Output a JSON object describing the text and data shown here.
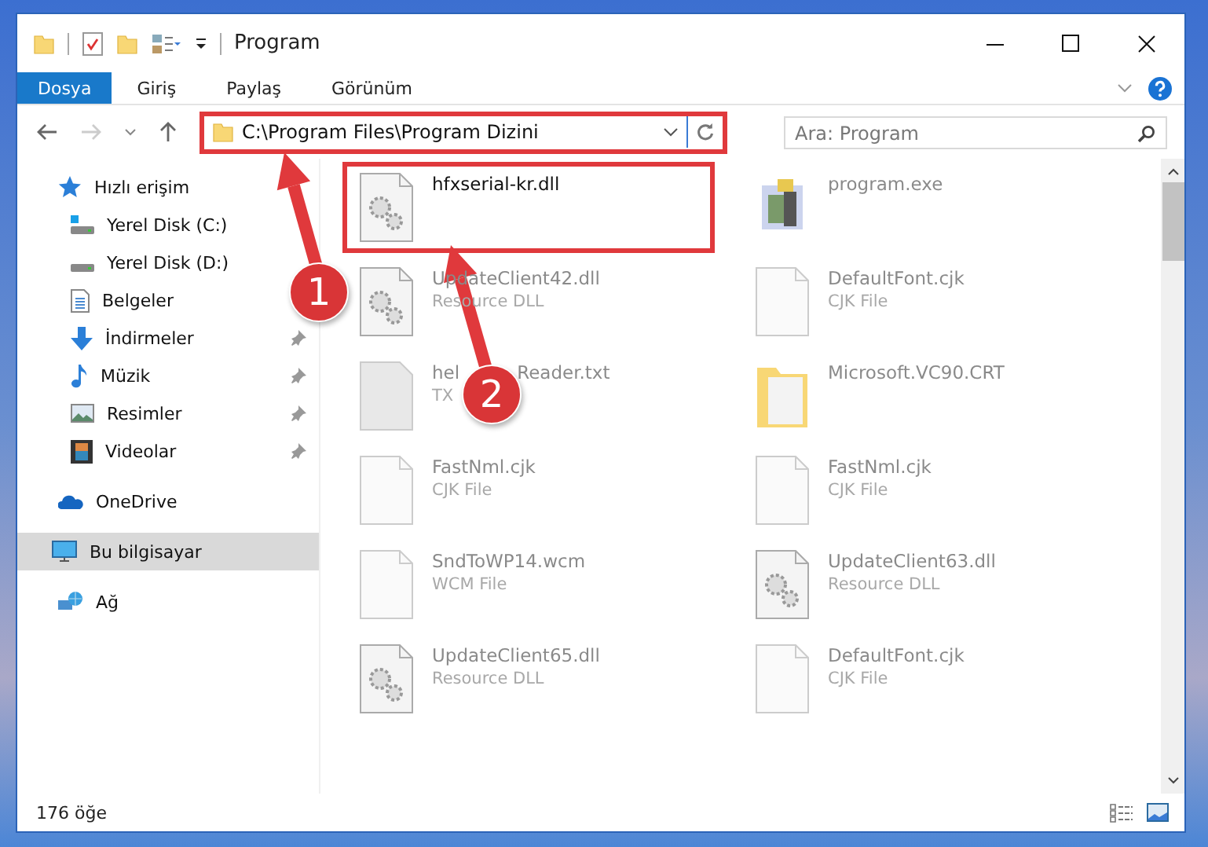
{
  "window": {
    "title": "Program"
  },
  "ribbon_tabs": [
    {
      "label": "Dosya",
      "selected": true
    },
    {
      "label": "Giriş",
      "selected": false
    },
    {
      "label": "Paylaş",
      "selected": false
    },
    {
      "label": "Görünüm",
      "selected": false
    }
  ],
  "address_bar": {
    "path": "C:\\Program Files\\Program Dizini",
    "highlighted": true
  },
  "search": {
    "placeholder": "Ara: Program"
  },
  "sidebar": {
    "items": [
      {
        "label": "Hızlı erişim",
        "kind": "star",
        "pinned": false,
        "selected": false,
        "children": [
          {
            "label": "Yerel Disk (C:)",
            "kind": "drive-c",
            "pinned": false,
            "selected": false
          },
          {
            "label": "Yerel Disk (D:)",
            "kind": "drive",
            "pinned": false,
            "selected": false
          },
          {
            "label": "Belgeler",
            "kind": "document",
            "pinned": false,
            "selected": false
          },
          {
            "label": "İndirmeler",
            "kind": "download",
            "pinned": true,
            "selected": false
          },
          {
            "label": "Müzik",
            "kind": "music",
            "pinned": true,
            "selected": false
          },
          {
            "label": "Resimler",
            "kind": "image",
            "pinned": true,
            "selected": false
          },
          {
            "label": "Videolar",
            "kind": "video",
            "pinned": true,
            "selected": false
          }
        ]
      },
      {
        "label": "OneDrive",
        "kind": "cloud",
        "pinned": false,
        "selected": false
      },
      {
        "label": "Bu bilgisayar",
        "kind": "computer",
        "pinned": false,
        "selected": true
      },
      {
        "label": "Ağ",
        "kind": "network",
        "pinned": false,
        "selected": false
      }
    ]
  },
  "files": [
    {
      "name": "hfxserial-kr.dll",
      "kind": "dll",
      "highlighted": true
    },
    {
      "name": "program.exe",
      "kind": "exe",
      "highlighted": false
    },
    {
      "name": "UpdateClient42.dll",
      "type": "Resource DLL",
      "kind": "dll",
      "highlighted": false
    },
    {
      "name": "DefaultFont.cjk",
      "type": "CJK File",
      "kind": "blank",
      "highlighted": false
    },
    {
      "name": "hel          Reader.txt",
      "type": "TX",
      "kind": "text",
      "highlighted": false
    },
    {
      "name": "Microsoft.VC90.CRT",
      "kind": "folder",
      "highlighted": false
    },
    {
      "name": "FastNml.cjk",
      "type": "CJK File",
      "kind": "blank",
      "highlighted": false
    },
    {
      "name": "FastNml.cjk",
      "type": "CJK File",
      "kind": "blank",
      "highlighted": false
    },
    {
      "name": "SndToWP14.wcm",
      "type": "WCM File",
      "kind": "blank",
      "highlighted": false
    },
    {
      "name": "UpdateClient63.dll",
      "type": "Resource DLL",
      "kind": "dll",
      "highlighted": false
    },
    {
      "name": "UpdateClient65.dll",
      "type": "Resource DLL",
      "kind": "dll",
      "highlighted": false
    },
    {
      "name": "DefaultFont.cjk",
      "type": "CJK File",
      "kind": "blank",
      "highlighted": false
    }
  ],
  "status_bar": {
    "count": "176 öğe"
  },
  "annotations": [
    {
      "label": "1"
    },
    {
      "label": "2"
    }
  ]
}
